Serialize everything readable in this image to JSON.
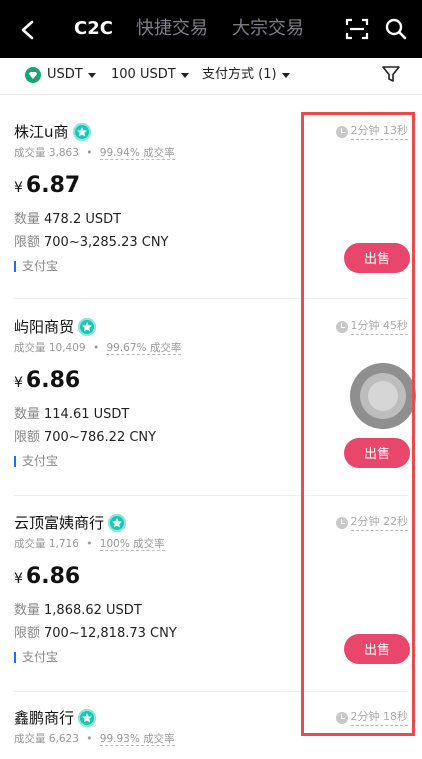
{
  "header": {
    "tabs": [
      {
        "label": "C2C",
        "active": true
      },
      {
        "label": "快捷交易",
        "active": false
      },
      {
        "label": "大宗交易",
        "active": false
      }
    ],
    "icons": {
      "back": "back-arrow-icon",
      "scan": "scan-icon",
      "search": "search-icon"
    }
  },
  "filters": {
    "asset": "USDT",
    "amount": "100 USDT",
    "payment": "支付方式 (1)",
    "icon": "filter-icon"
  },
  "listings": [
    {
      "name": "株江u商",
      "volume_label": "成交量",
      "volume": "3,863",
      "rate": "99.94%",
      "rate_label": "成交率",
      "time": "2分钟 13秒",
      "currency": "¥",
      "price": "6.87",
      "quantity_label": "数量",
      "quantity": "478.2 USDT",
      "limit_label": "限额",
      "limit": "700~3,285.23 CNY",
      "payment": "支付宝",
      "action": "出售"
    },
    {
      "name": "屿阳商贸",
      "volume_label": "成交量",
      "volume": "10,409",
      "rate": "99.67%",
      "rate_label": "成交率",
      "time": "1分钟 45秒",
      "currency": "¥",
      "price": "6.86",
      "quantity_label": "数量",
      "quantity": "114.61 USDT",
      "limit_label": "限额",
      "limit": "700~786.22 CNY",
      "payment": "支付宝",
      "action": "出售"
    },
    {
      "name": "云顶富姨商行",
      "volume_label": "成交量",
      "volume": "1,716",
      "rate": "100%",
      "rate_label": "成交率",
      "time": "2分钟 22秒",
      "currency": "¥",
      "price": "6.86",
      "quantity_label": "数量",
      "quantity": "1,868.62 USDT",
      "limit_label": "限额",
      "limit": "700~12,818.73 CNY",
      "payment": "支付宝",
      "action": "出售"
    },
    {
      "name": "鑫鹏商行",
      "volume_label": "成交量",
      "volume": "6,623",
      "rate": "99.93%",
      "rate_label": "成交率",
      "time": "2分钟 18秒"
    }
  ],
  "colors": {
    "header_bg": "#000000",
    "accent_sell": "#e8466a",
    "verified_badge": "#1bc6b3",
    "payment_marker": "#1e6fff",
    "highlight_box": "#e84c4c"
  }
}
